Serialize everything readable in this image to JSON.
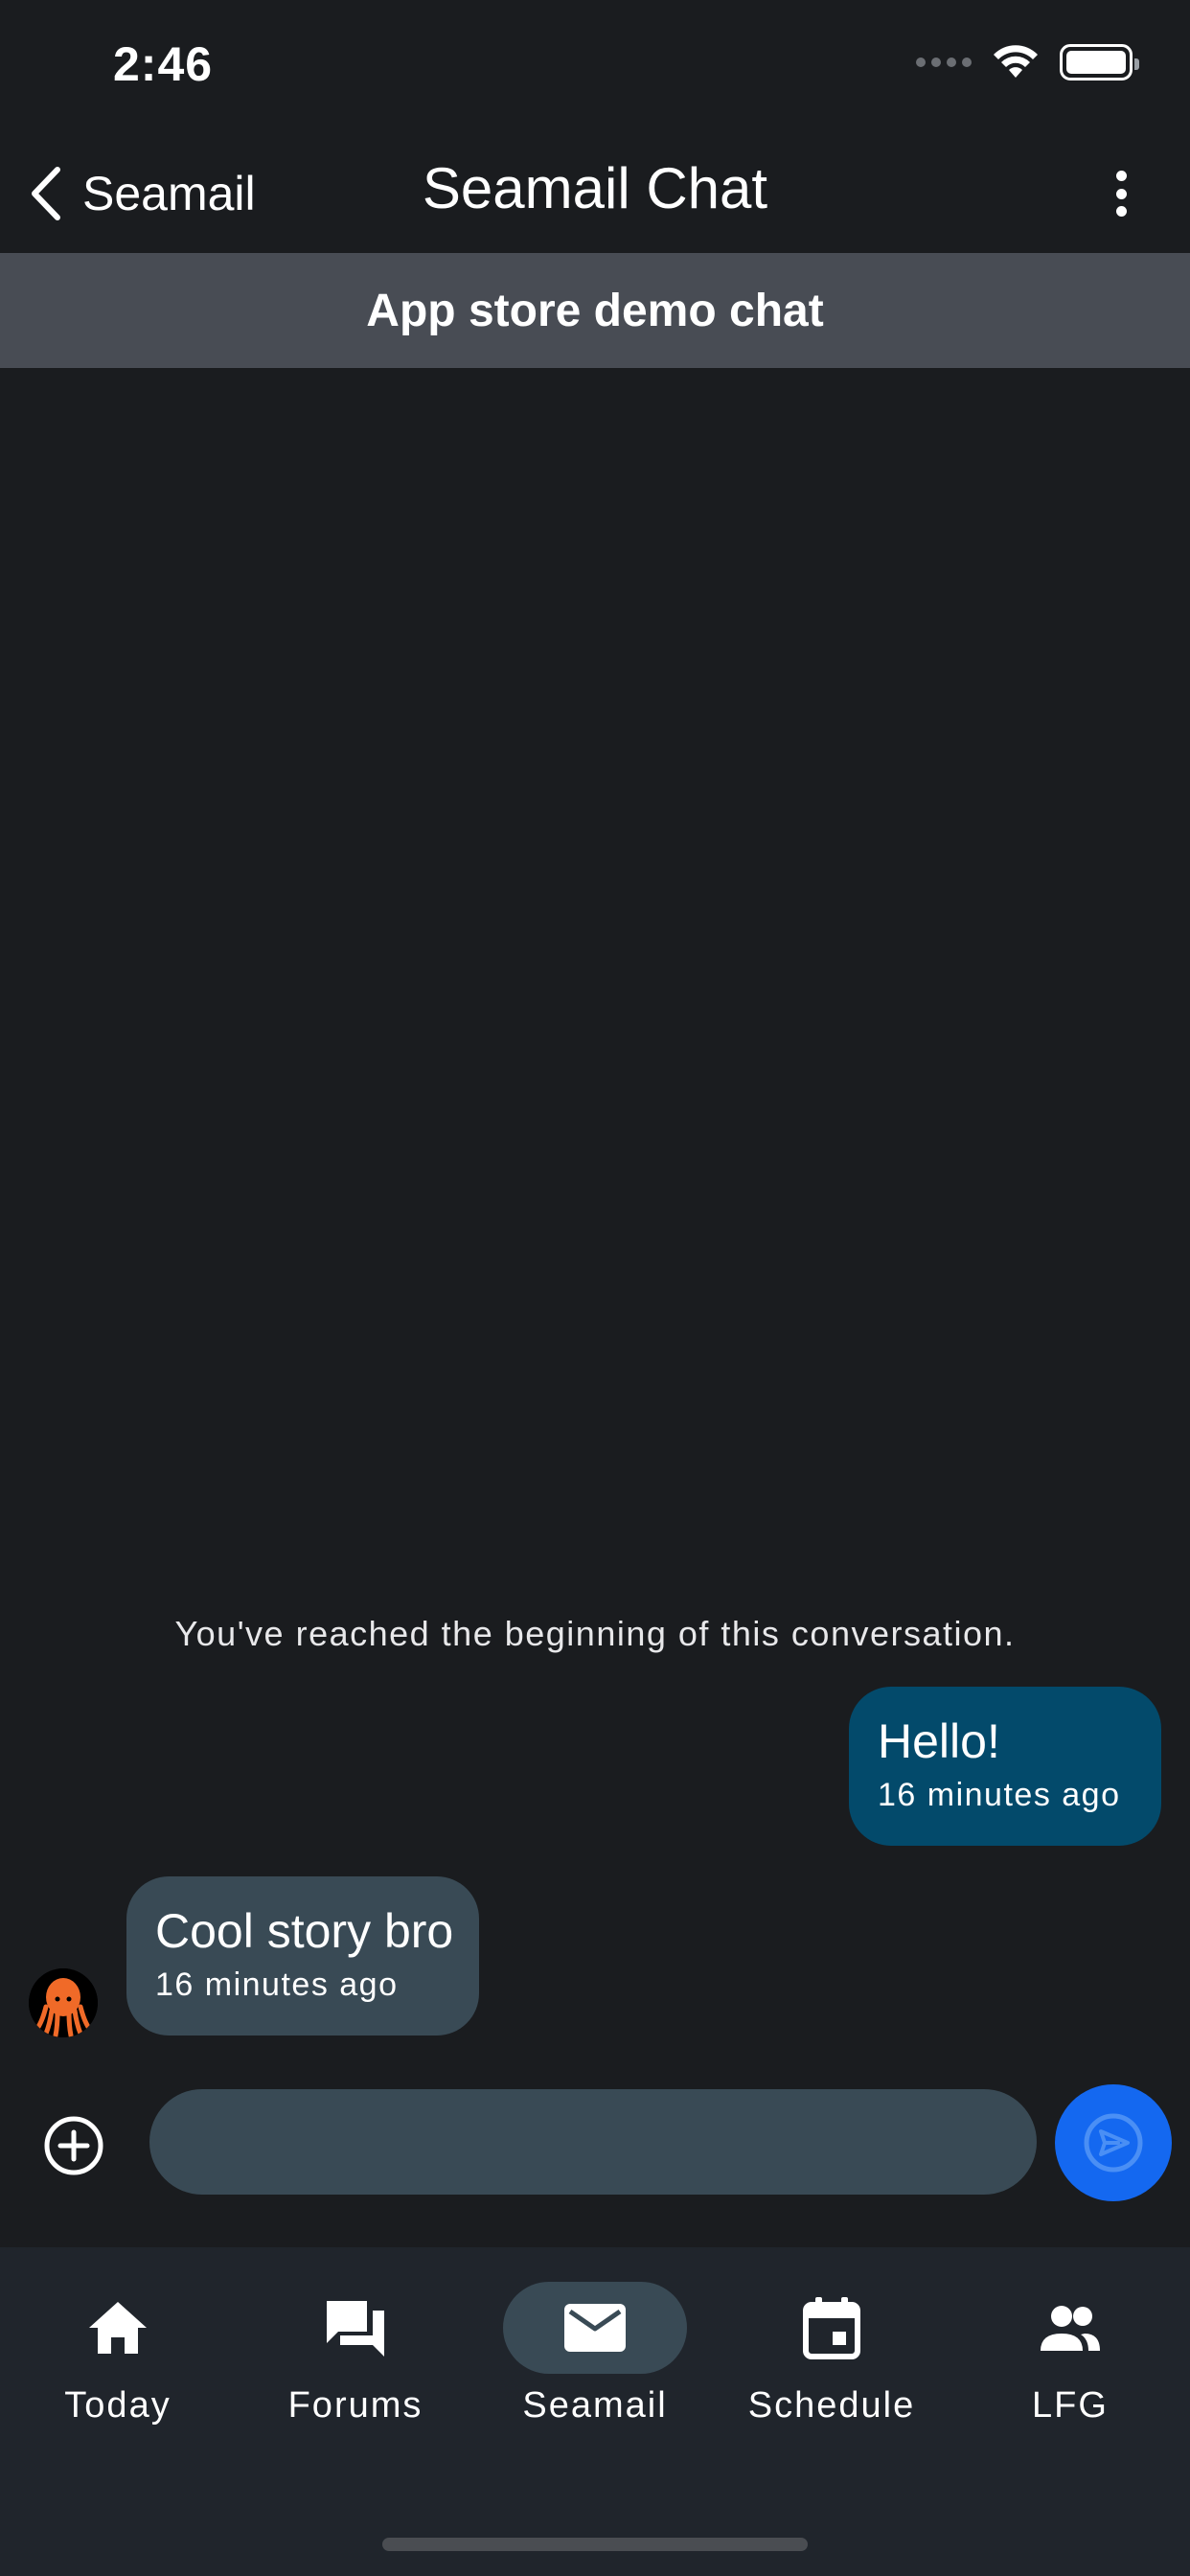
{
  "status_bar": {
    "time": "2:46"
  },
  "app_bar": {
    "back_label": "Seamail",
    "title": "Seamail Chat"
  },
  "chat": {
    "title": "App store demo chat",
    "conversation_start": "You've reached the beginning of this conversation.",
    "messages": [
      {
        "direction": "sent",
        "text": "Hello!",
        "time": "16 minutes ago"
      },
      {
        "direction": "received",
        "text": "Cool story bro",
        "time": "16 minutes ago"
      }
    ]
  },
  "composer": {
    "value": "",
    "placeholder": ""
  },
  "nav": {
    "items": [
      {
        "label": "Today",
        "icon": "home-icon"
      },
      {
        "label": "Forums",
        "icon": "forum-icon"
      },
      {
        "label": "Seamail",
        "icon": "mail-icon",
        "active": true
      },
      {
        "label": "Schedule",
        "icon": "calendar-icon"
      },
      {
        "label": "LFG",
        "icon": "people-icon"
      }
    ]
  },
  "colors": {
    "background": "#1a1c1f",
    "chat_header": "#484c54",
    "sent_bubble": "#034a6b",
    "received_bubble": "#394a55",
    "send_button": "#1468f0",
    "nav_background": "#20252c",
    "avatar_accent": "#f06a28"
  }
}
